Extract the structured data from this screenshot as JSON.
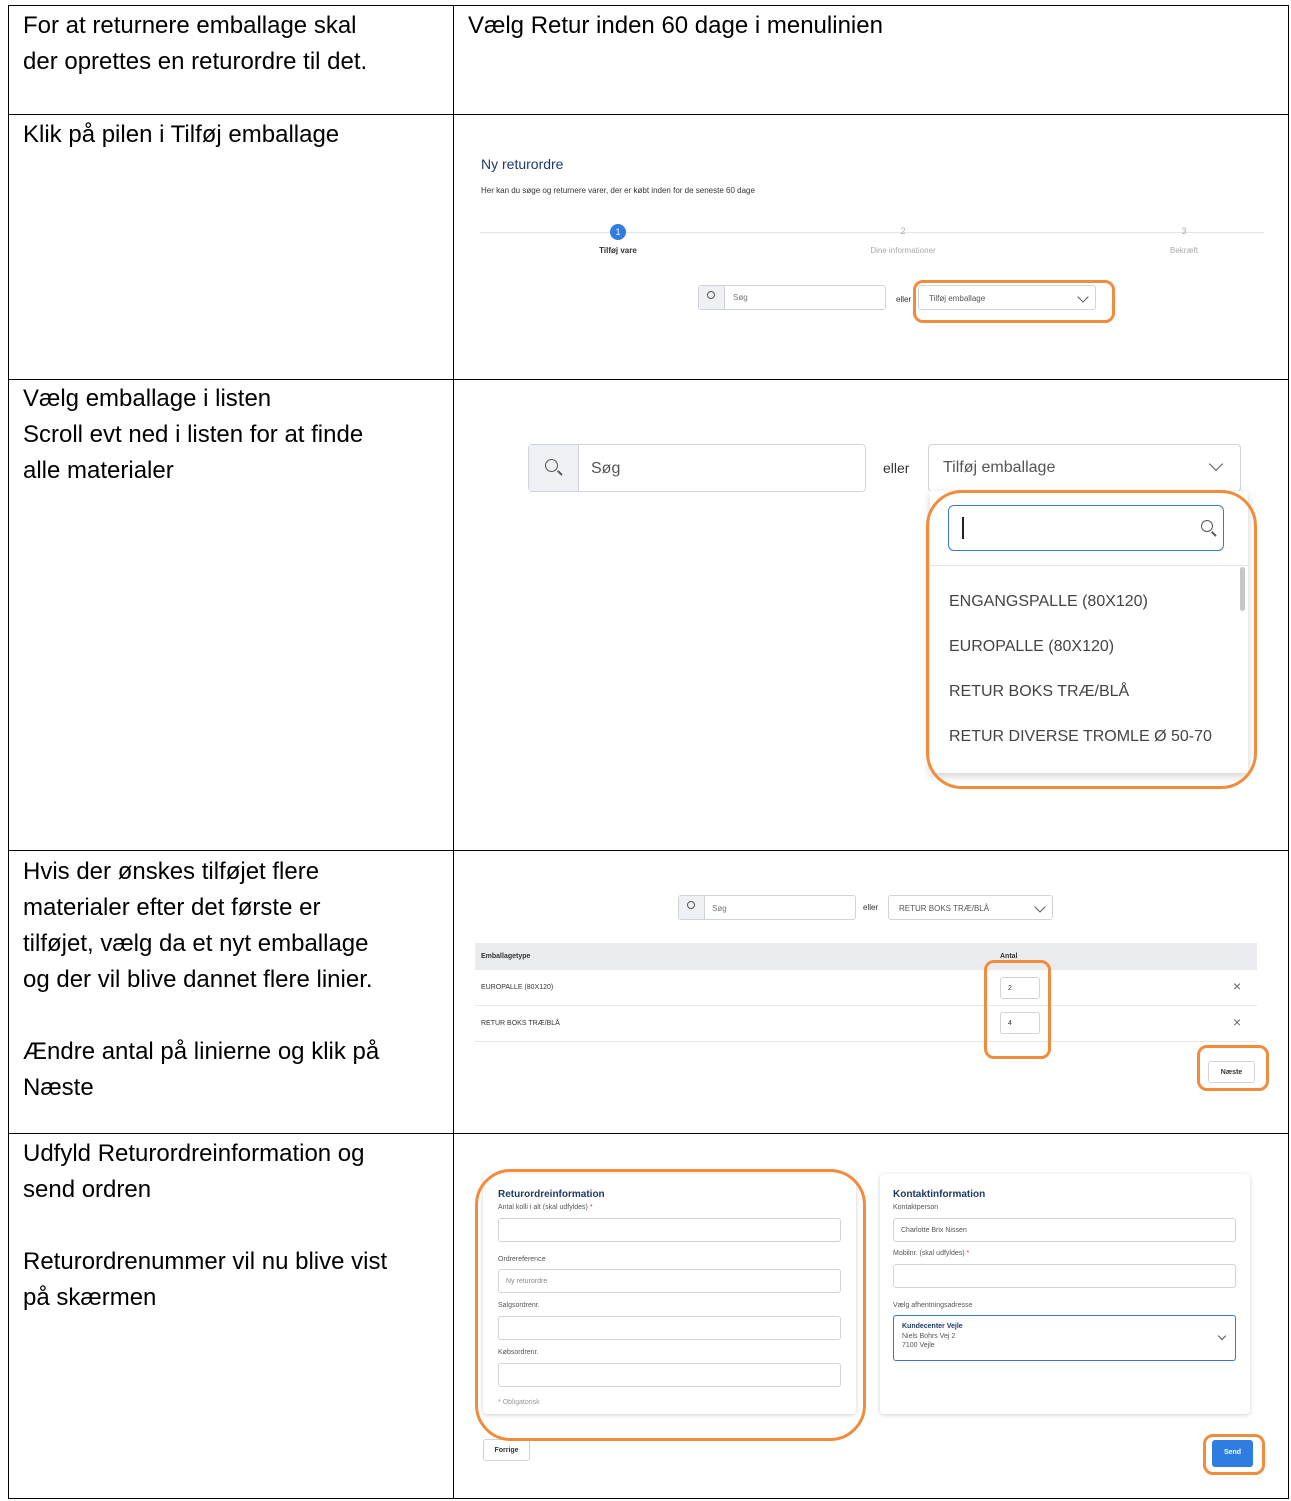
{
  "rows": [
    {
      "left": "For at returnere emballage skal\nder oprettes en returordre til det.",
      "right": "Vælg Retur inden 60 dage i menulinien"
    },
    {
      "left": "Klik på pilen i Tilføj emballage"
    },
    {
      "left": "Vælg emballage i listen\nScroll evt ned i listen for at finde\nalle materialer"
    },
    {
      "left": "Hvis der ønskes tilføjet flere\nmaterialer efter det første er\ntilføjet, vælg da et nyt emballage\nog der vil blive dannet flere linier.\n\nÆndre antal på linierne og klik på\nNæste"
    },
    {
      "left": "Udfyld Returordreinformation og\nsend ordren\n\nReturordrenummer vil nu blive vist\npå skærmen"
    }
  ],
  "shot1": {
    "title": "Ny returordre",
    "subtitle": "Her kan du søge og returnere varer, der er købt inden for de seneste 60 dage",
    "steps": [
      {
        "num": "1",
        "label": "Tilføj vare"
      },
      {
        "num": "2",
        "label": "Dine informationer"
      },
      {
        "num": "3",
        "label": "Bekræft"
      }
    ],
    "search_placeholder": "Søg",
    "or_label": "eller",
    "select_label": "Tilføj emballage"
  },
  "shot2": {
    "search_placeholder": "Søg",
    "or_label": "eller",
    "select_label": "Tilføj emballage",
    "options": [
      "ENGANGSPALLE (80X120)",
      "EUROPALLE (80X120)",
      "RETUR BOKS TRÆ/BLÅ",
      "RETUR DIVERSE TROMLE Ø 50-70"
    ]
  },
  "shot3": {
    "search_placeholder": "Søg",
    "or_label": "eller",
    "select_value": "RETUR BOKS TRÆ/BLÅ",
    "col_type": "Emballagetype",
    "col_qty": "Antal",
    "lines": [
      {
        "type": "EUROPALLE (80X120)",
        "qty": "2"
      },
      {
        "type": "RETUR BOKS TRÆ/BLÅ",
        "qty": "4"
      }
    ],
    "next_label": "Næste"
  },
  "shot4": {
    "left_title": "Returordreinformation",
    "f1_label": "Antal kolli i alt (skal udfyldes)",
    "f2_label": "Ordrereference",
    "f2_value": "Ny returordre",
    "f3_label": "Salgsordrenr.",
    "f4_label": "Købsordrenr.",
    "required_note": "* Obligatorisk",
    "right_title": "Kontaktinformation",
    "r1_label": "Kontaktperson",
    "r1_value": "Charlotte Brix Nissen",
    "r2_label": "Mobilnr. (skal udfyldes)",
    "r3_label": "Vælg afhentningsadresse",
    "addr_name": "Kundecenter Vejle",
    "addr_street": "Niels Bohrs Vej 2",
    "addr_city": "7100 Vejle",
    "prev_label": "Forrige",
    "send_label": "Send",
    "required_star": "*"
  },
  "colors": {
    "accent": "#f08c3c",
    "primary": "#2f7de1",
    "title": "#1f3a64"
  }
}
